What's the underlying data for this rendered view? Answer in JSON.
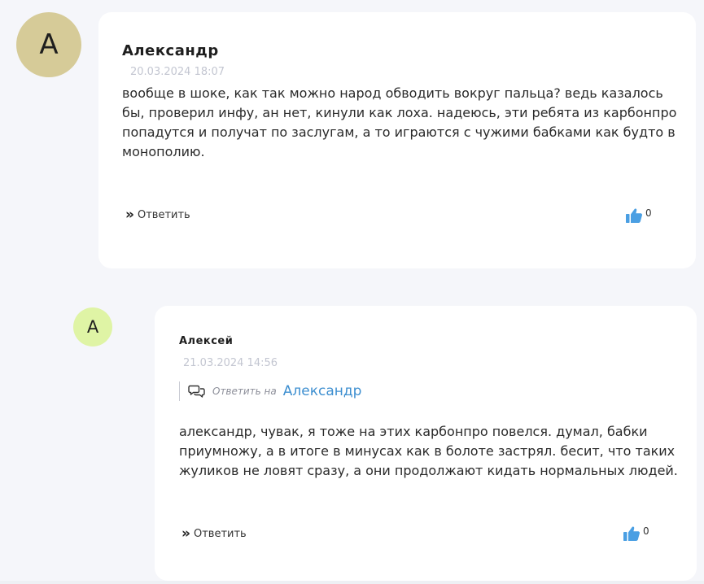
{
  "comments": [
    {
      "avatar_letter": "A",
      "author": "Александр",
      "date": "20.03.2024 18:07",
      "text": "вообще в шоке, как так можно народ обводить вокруг пальца? ведь казалось бы, проверил инфу, ан нет, кинули как лоха. надеюсь, эти ребята из карбонпро попадутся и получат по заслугам, а то играются с чужими бабками как будто в монополию.",
      "reply_label": "Ответить",
      "likes": "0"
    },
    {
      "avatar_letter": "A",
      "author": "Алексей",
      "date": "21.03.2024 14:56",
      "reply_to_label": "Ответить на",
      "reply_to_name": "Александр",
      "text": "александр, чувак, я тоже на этих карбонпро повелся. думал, бабки приумножу, а в итоге в минусах как в болоте застрял. бесит, что таких жуликов не ловят сразу, а они продолжают кидать нормальных людей.",
      "reply_label": "Ответить",
      "likes": "0"
    }
  ],
  "icons": {
    "reply": "double-chevron-right-icon",
    "like": "thumbs-up-icon",
    "reply_to": "chat-bubbles-icon"
  },
  "colors": {
    "like": "#4a9fe3",
    "reply_to_name": "#3e8fd0",
    "avatar_1": "#d6cb98",
    "avatar_2": "#dff4a5"
  }
}
